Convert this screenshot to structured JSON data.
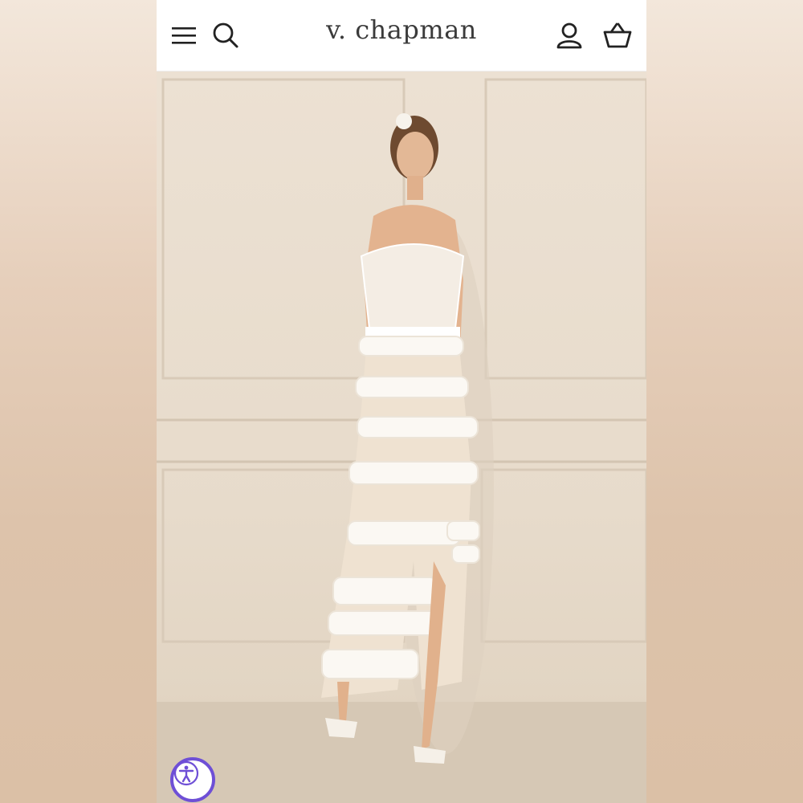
{
  "header": {
    "brand": "v. chapman",
    "icons": [
      "menu-icon",
      "search-icon",
      "account-icon",
      "basket-icon"
    ]
  },
  "hero": {
    "image": "product-photo-white-lace-ruffle-maxi-dress"
  },
  "accessibility": {
    "icon": "accessibility-icon",
    "color": "#6e4fd6"
  }
}
